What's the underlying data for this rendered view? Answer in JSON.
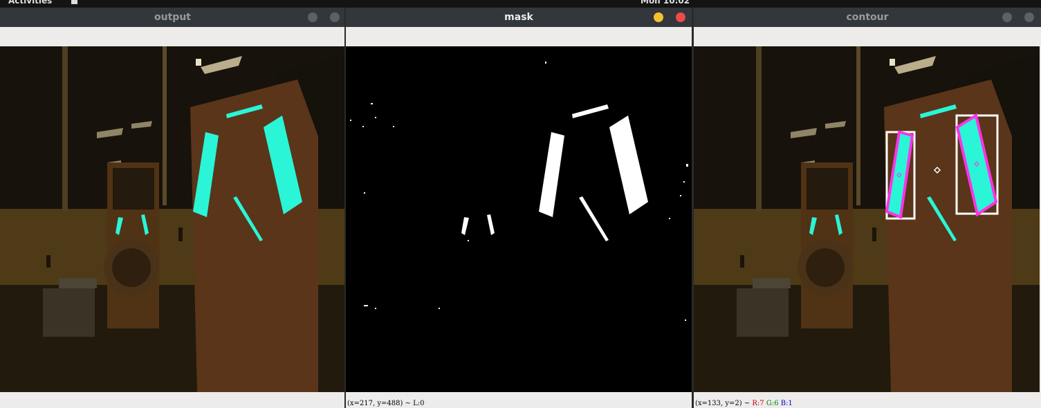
{
  "topbar": {
    "activities": "Activities",
    "clock": "Mon 10:02"
  },
  "windows": {
    "output": {
      "title": "output"
    },
    "mask": {
      "title": "mask",
      "status": "(x=217, y=488) ~ L:0"
    },
    "contour": {
      "title": "contour",
      "status_prefix": "(x=133, y=2) ~",
      "r": "R:7",
      "g": "G:6",
      "b": "B:1"
    }
  },
  "colors": {
    "highlight": "#2af5d6",
    "contour": "#ff33e6",
    "titlebar": "#33363b",
    "close": "#ef4a4a",
    "minimize": "#f5c130"
  }
}
